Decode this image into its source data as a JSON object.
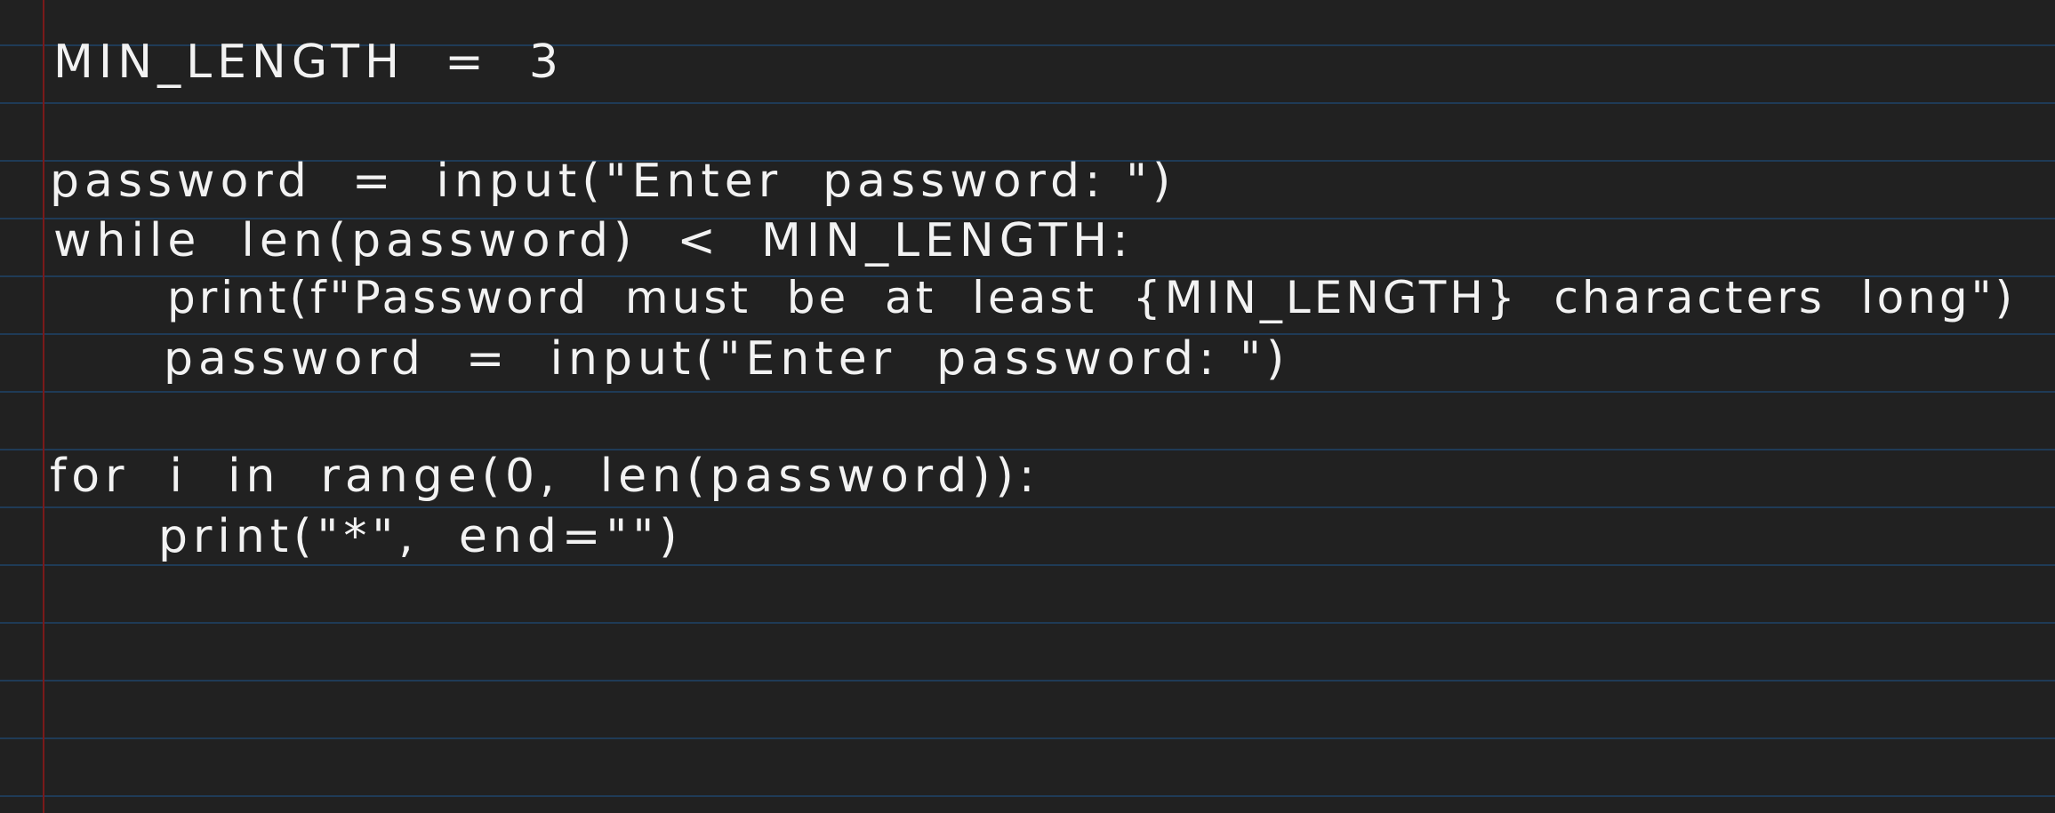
{
  "notebook": {
    "lines": [
      "MIN_LENGTH  =  3",
      "password  =  input(\"Enter  password: \")",
      "while  len(password)  <  MIN_LENGTH:",
      "print(f\"Password  must  be  at  least  {MIN_LENGTH}  characters  long\")",
      "password  =  input(\"Enter  password: \")",
      "for  i  in  range(0,  len(password)):",
      "print(\"*\",  end=\"\")"
    ]
  }
}
